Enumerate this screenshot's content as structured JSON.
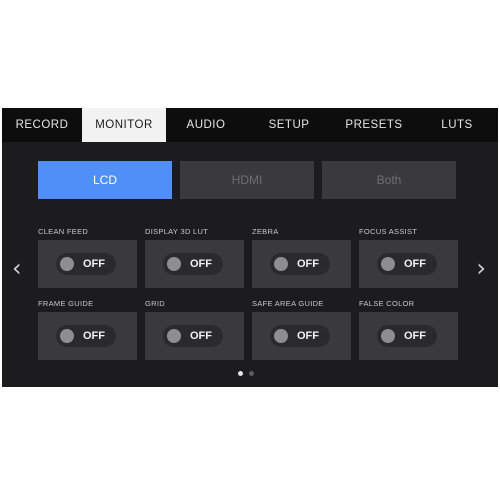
{
  "tabs": [
    {
      "label": "RECORD",
      "active": false
    },
    {
      "label": "MONITOR",
      "active": true
    },
    {
      "label": "AUDIO",
      "active": false
    },
    {
      "label": "SETUP",
      "active": false
    },
    {
      "label": "PRESETS",
      "active": false
    },
    {
      "label": "LUTS",
      "active": false
    }
  ],
  "outputs": [
    {
      "label": "LCD",
      "selected": true
    },
    {
      "label": "HDMI",
      "selected": false
    },
    {
      "label": "Both",
      "selected": false
    }
  ],
  "settings": [
    {
      "label": "CLEAN FEED",
      "state": "OFF"
    },
    {
      "label": "DISPLAY 3D LUT",
      "state": "OFF"
    },
    {
      "label": "ZEBRA",
      "state": "OFF"
    },
    {
      "label": "FOCUS ASSIST",
      "state": "OFF"
    },
    {
      "label": "FRAME GUIDE",
      "state": "OFF"
    },
    {
      "label": "GRID",
      "state": "OFF"
    },
    {
      "label": "SAFE AREA GUIDE",
      "state": "OFF"
    },
    {
      "label": "FALSE COLOR",
      "state": "OFF"
    }
  ],
  "nav": {
    "prev_glyph": "‹",
    "next_glyph": "›"
  },
  "pagination": {
    "current": 1,
    "total": 2
  },
  "colors": {
    "accent": "#4f8ff7",
    "background": "#1c1c1e",
    "tile": "#3a3a3c"
  }
}
